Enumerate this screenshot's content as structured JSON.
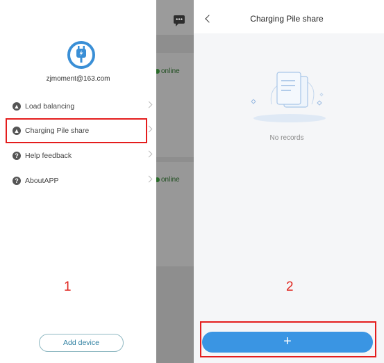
{
  "left_screen": {
    "email": "zjmoment@163.com",
    "menu": [
      {
        "label": "Load balancing",
        "icon": "load-balance-icon"
      },
      {
        "label": "Charging Pile share",
        "icon": "share-icon"
      },
      {
        "label": "Help feedback",
        "icon": "help-icon"
      },
      {
        "label": "AboutAPP",
        "icon": "info-icon"
      }
    ],
    "add_device_label": "Add device",
    "status_online": "online",
    "step_label": "1"
  },
  "right_screen": {
    "title": "Charging Pile share",
    "empty_text": "No records",
    "add_button_label": "+",
    "step_label": "2"
  },
  "colors": {
    "accent": "#3a95e3",
    "highlight": "#e41d1d",
    "logo": "#3a8fd6"
  }
}
